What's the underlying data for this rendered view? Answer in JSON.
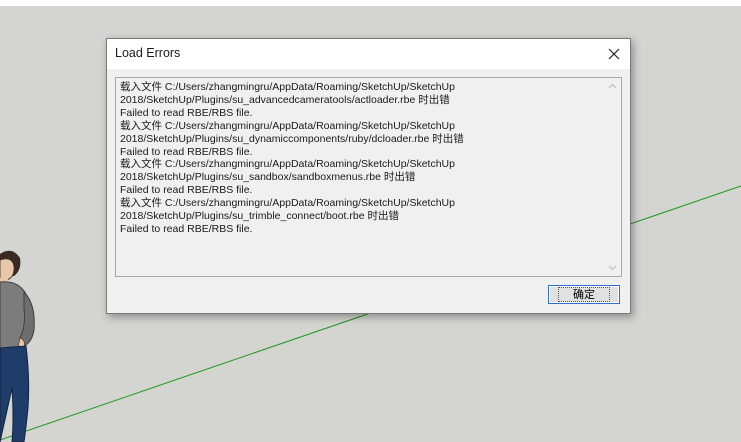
{
  "dialog": {
    "title": "Load Errors",
    "message": "载入文件 C:/Users/zhangmingru/AppData/Roaming/SketchUp/SketchUp\n2018/SketchUp/Plugins/su_advancedcameratools/actloader.rbe 时出错\nFailed to read RBE/RBS file.\n载入文件 C:/Users/zhangmingru/AppData/Roaming/SketchUp/SketchUp\n2018/SketchUp/Plugins/su_dynamiccomponents/ruby/dcloader.rbe 时出错\nFailed to read RBE/RBS file.\n载入文件 C:/Users/zhangmingru/AppData/Roaming/SketchUp/SketchUp\n2018/SketchUp/Plugins/su_sandbox/sandboxmenus.rbe 时出错\nFailed to read RBE/RBS file.\n载入文件 C:/Users/zhangmingru/AppData/Roaming/SketchUp/SketchUp\n2018/SketchUp/Plugins/su_trimble_connect/boot.rbe 时出错\nFailed to read RBE/RBS file.",
    "ok_label": "确定"
  },
  "icons": {
    "close": "close-icon",
    "scroll_up": "scroll-up-arrow-icon",
    "scroll_down": "scroll-down-arrow-icon"
  },
  "colors": {
    "viewport_background": "#d4d4d1",
    "axis_green": "#1a9a1a",
    "button_focus_border": "#2f6fd1"
  }
}
